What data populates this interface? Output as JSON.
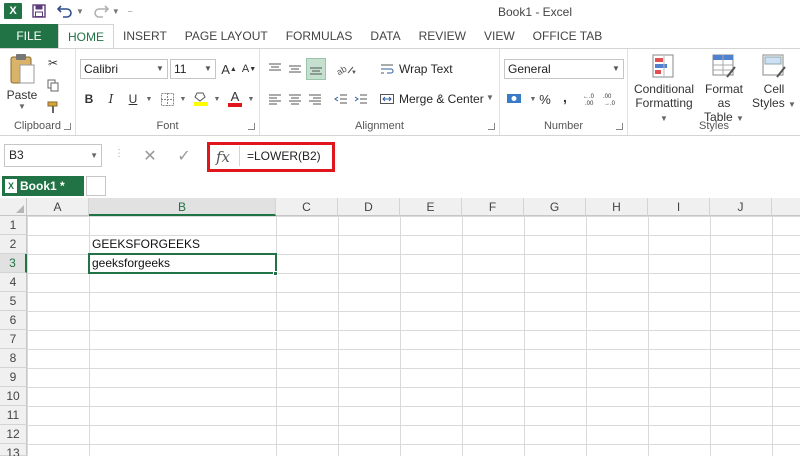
{
  "app": {
    "title": "Book1 - Excel",
    "logo": "X"
  },
  "qat": {
    "save_icon": "save-icon",
    "undo_icon": "undo-icon",
    "redo_icon": "redo-icon"
  },
  "tabs": [
    {
      "label": "FILE"
    },
    {
      "label": "HOME"
    },
    {
      "label": "INSERT"
    },
    {
      "label": "PAGE LAYOUT"
    },
    {
      "label": "FORMULAS"
    },
    {
      "label": "DATA"
    },
    {
      "label": "REVIEW"
    },
    {
      "label": "VIEW"
    },
    {
      "label": "OFFICE TAB"
    }
  ],
  "ribbon": {
    "clipboard": {
      "paste_label": "Paste",
      "group_label": "Clipboard"
    },
    "font": {
      "family": "Calibri",
      "size": "11",
      "bold": "B",
      "italic": "I",
      "underline": "U",
      "grow": "A",
      "shrink": "A",
      "font_color": "A",
      "group_label": "Font"
    },
    "alignment": {
      "wrap_text": "Wrap Text",
      "merge_center": "Merge & Center",
      "group_label": "Alignment"
    },
    "number": {
      "format": "General",
      "currency": "$",
      "percent": "%",
      "comma": ",",
      "inc_dec": ".0→.00",
      "dec_dec": ".00→.0",
      "group_label": "Number"
    },
    "styles": {
      "conditional_1": "Conditional",
      "conditional_2": "Formatting",
      "format_table_1": "Format as",
      "format_table_2": "Table",
      "cell_styles_1": "Cell",
      "cell_styles_2": "Styles",
      "group_label": "Styles"
    }
  },
  "formula_bar": {
    "name_box": "B3",
    "cancel": "✕",
    "enter": "✓",
    "fx": "fx",
    "formula": "=LOWER(B2)"
  },
  "workbook_tab": {
    "label": "Book1 *"
  },
  "grid": {
    "columns": [
      "A",
      "B",
      "C",
      "D",
      "E",
      "F",
      "G",
      "H",
      "I",
      "J"
    ],
    "rows": [
      "1",
      "2",
      "3",
      "4",
      "5",
      "6",
      "7",
      "8",
      "9",
      "10",
      "11",
      "12",
      "13"
    ],
    "selected_column": "B",
    "selected_row": "3",
    "cells": {
      "B2": "GEEKSFORGEEKS",
      "B3": "geeksforgeeks"
    }
  },
  "colors": {
    "accent": "#217346",
    "highlight": "#e0161d"
  }
}
